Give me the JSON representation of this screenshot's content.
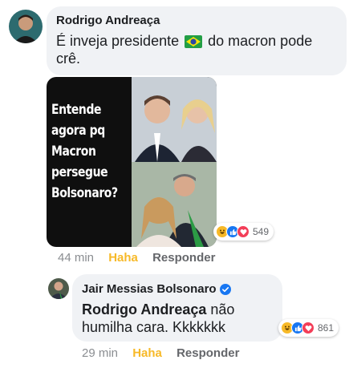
{
  "comment1": {
    "author": "Rodrigo Andreaça",
    "text_before_flag": "É inveja presidente",
    "flag_icon": "brazil-flag",
    "text_after_flag": "do macron pode crê.",
    "image": {
      "text": "Entende agora pq Macron persegue Bolsonaro?"
    },
    "reactions": {
      "icons": [
        "haha",
        "like",
        "love"
      ],
      "count": "549"
    },
    "time": "44 min",
    "reaction_label": "Haha",
    "reply_label": "Responder"
  },
  "comment2": {
    "author": "Jair Messias Bolsonaro",
    "verified": true,
    "mention": "Rodrigo Andreaça",
    "text": " não humilha cara. Kkkkkkk",
    "reactions": {
      "icons": [
        "haha",
        "like",
        "love"
      ],
      "count": "861"
    },
    "time": "29 min",
    "reaction_label": "Haha",
    "reply_label": "Responder"
  },
  "colors": {
    "bubble": "#f0f2f5",
    "haha": "#f7b928",
    "like": "#1877f2",
    "love": "#f33e58",
    "meta": "#65676b"
  }
}
